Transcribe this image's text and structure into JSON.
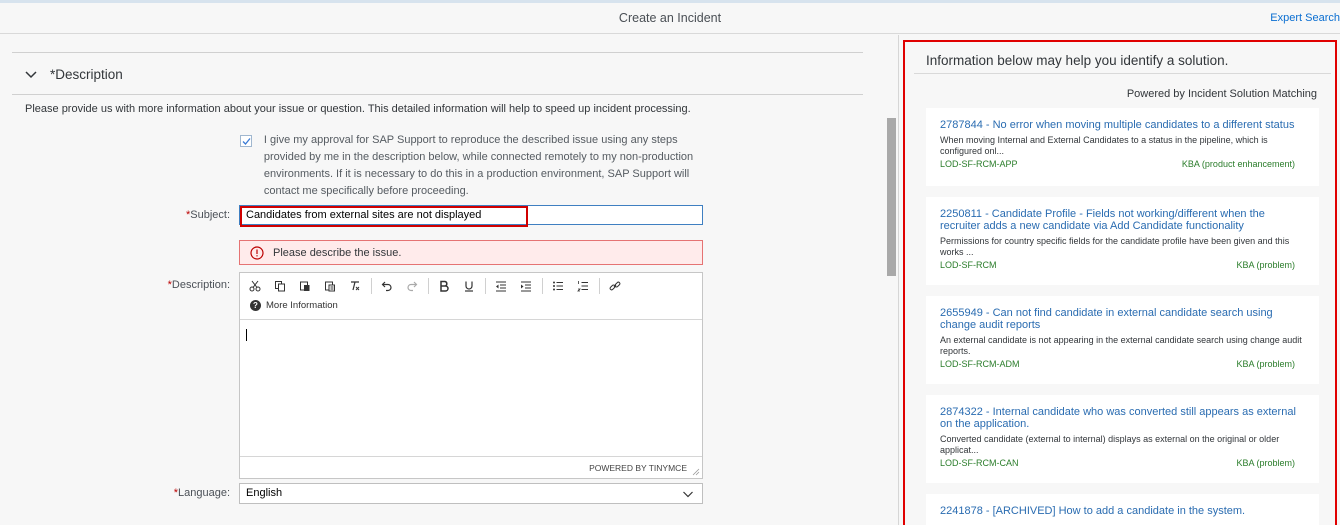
{
  "header": {
    "title": "Create an Incident",
    "expert_search": "Expert Search"
  },
  "description_section": {
    "heading": "*Description",
    "intro": "Please provide us with more information about your issue or question. This detailed information will help to speed up incident processing.",
    "approval_text": "I give my approval for SAP Support to reproduce the described issue using any steps provided by me in the description below, while connected remotely to my non-production environments. If it is necessary to do this in a production environment, SAP Support will contact me specifically before proceeding.",
    "approval_checked": true
  },
  "form": {
    "subject_label": "Subject:",
    "subject_value": "Candidates from external sites are not displayed",
    "error_message": "Please describe the issue.",
    "description_label": "Description:",
    "more_information": "More Information",
    "editor_powered_by": "POWERED BY TINYMCE",
    "language_label": "Language:",
    "language_value": "English",
    "required_marker": "*"
  },
  "toolbar_icons": [
    "cut-icon",
    "copy-icon",
    "paste-icon",
    "paste-text-icon",
    "clear-format-icon",
    "undo-icon",
    "redo-icon",
    "bold-icon",
    "underline-icon",
    "outdent-icon",
    "indent-icon",
    "bullet-list-icon",
    "numbered-list-icon",
    "link-icon"
  ],
  "solutions": {
    "title": "Information below may help you identify a solution.",
    "powered_by": "Powered by Incident Solution Matching",
    "cards": [
      {
        "title": "2787844 - No error when moving multiple candidates to a different status",
        "desc": "When moving Internal and External Candidates to a status in the pipeline, which is configured onl...",
        "component": "LOD-SF-RCM-APP",
        "type": "KBA (product enhancement)"
      },
      {
        "title": "2250811 - Candidate Profile - Fields not working/different when the recruiter adds a new candidate via Add Candidate functionality",
        "desc": "Permissions for country specific fields for the candidate profile have been given and this works ...",
        "component": "LOD-SF-RCM",
        "type": "KBA (problem)"
      },
      {
        "title": "2655949 - Can not find candidate in external candidate search using change audit reports",
        "desc": "An external candidate is not appearing in the external candidate search using change audit reports.",
        "component": "LOD-SF-RCM-ADM",
        "type": "KBA (problem)"
      },
      {
        "title": "2874322 - Internal candidate who was converted still appears as external on the application.",
        "desc": "Converted candidate (external to internal) displays as external on the original or older applicat...",
        "component": "LOD-SF-RCM-CAN",
        "type": "KBA (problem)"
      },
      {
        "title": "2241878 - [ARCHIVED] How to add a candidate in the system.",
        "desc": "",
        "component": "",
        "type": ""
      }
    ]
  },
  "colors": {
    "link": "#2a6cb1",
    "component_green": "#2b7d2b",
    "highlight_red": "#e00000",
    "required_red": "#bb0000"
  }
}
